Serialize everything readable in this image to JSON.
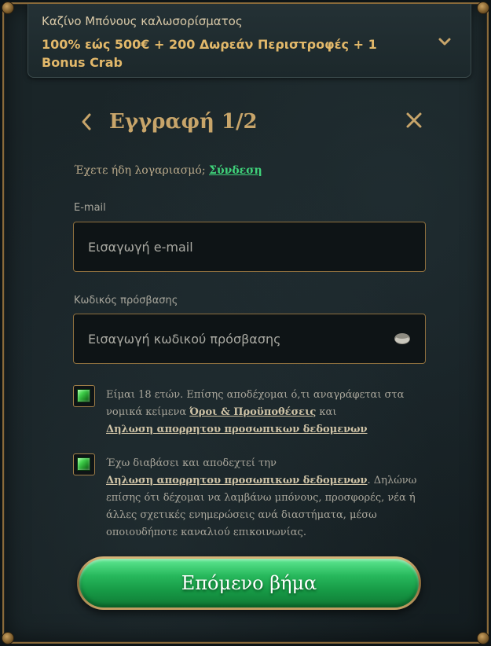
{
  "banner": {
    "subtitle": "Καζίνο Μπόνους καλωσορίσματος",
    "offer": "100% εώς 500€ + 200 Δωρεάν Περιστροφές + 1 Bonus Crab",
    "toggle_icon": "chevron-down-icon"
  },
  "header": {
    "title": "Εγγραφή 1/2",
    "back_icon": "chevron-left-icon",
    "close_icon": "close-icon"
  },
  "login_prompt": {
    "text": "Έχετε ήδη λογαριασμό;",
    "link": "Σύνδεση"
  },
  "email": {
    "label": "E-mail",
    "placeholder": "Εισαγωγή e-mail",
    "value": ""
  },
  "password": {
    "label": "Κωδικός πρόσβασης",
    "placeholder": "Εισαγωγή κωδικού πρόσβασης",
    "value": "",
    "visibility_icon": "eye-icon"
  },
  "consent_age": {
    "checked": true,
    "text_before": "Είμαι 18 ετών. Επίσης αποδέχομαι ό,τι αναγράφεται στα νομικά κείμενα",
    "link_terms": "Όροι & Προϋποθέσεις",
    "text_mid": "και",
    "link_privacy": "Δηλωση απορρητου προσωπικων δεδομενων"
  },
  "consent_marketing": {
    "checked": true,
    "text_before": "Έχω διαβάσει και αποδεχτεί την",
    "link_privacy": "Δηλωση απορρητου προσωπικων δεδομενων",
    "text_after": ". Δηλώνω επίσης ότι δέχομαι να λαμβάνω μπόνους, προσφορές, νέα ή άλλες σχετικές ενημερώσεις ανά διαστήματα, μέσω οποιουδήποτε καναλιού επικοινωνίας."
  },
  "next_button": {
    "label": "Επόμενο βήμα"
  },
  "colors": {
    "accent_gold": "#c8a56a",
    "link_green": "#3fd27a",
    "button_green": "#27b85c",
    "background": "#182226"
  }
}
